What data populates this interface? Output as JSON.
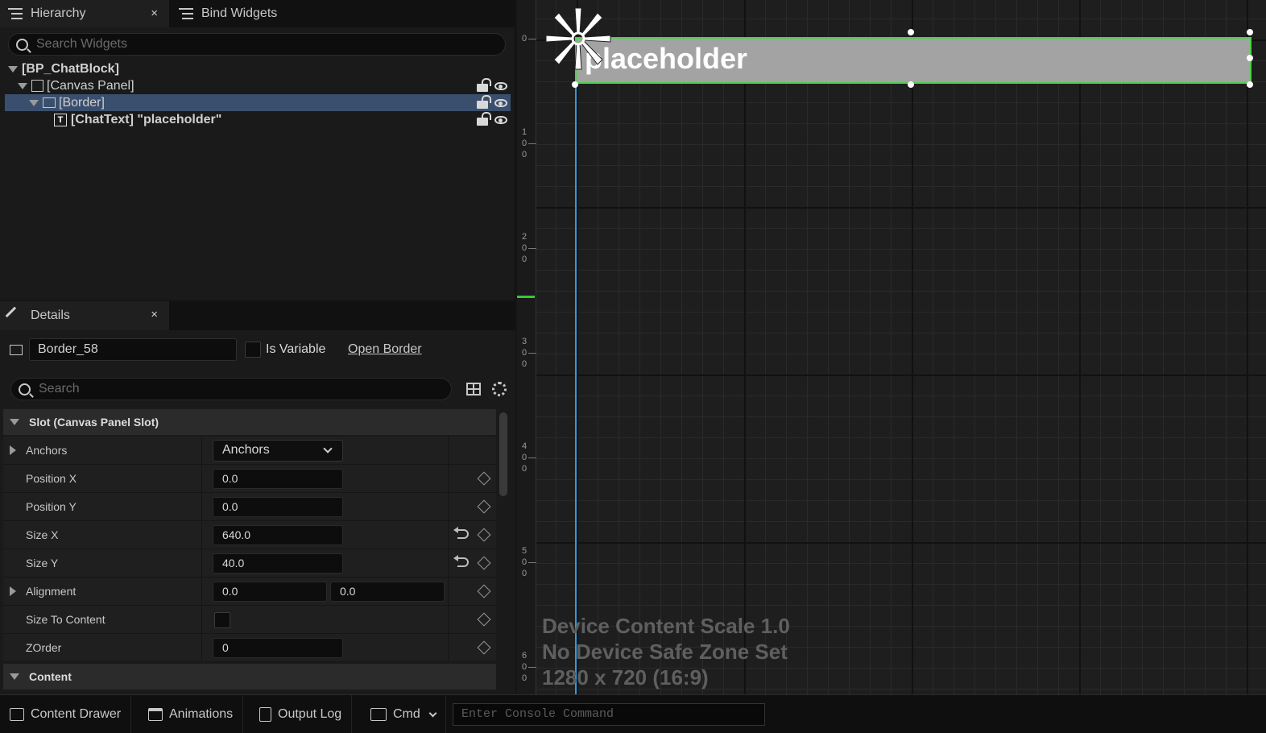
{
  "hierarchy": {
    "tabs": [
      {
        "label": "Hierarchy",
        "active": true
      },
      {
        "label": "Bind Widgets",
        "active": false
      }
    ],
    "close_glyph": "×",
    "search_placeholder": "Search Widgets",
    "tree": [
      {
        "label": "[BP_ChatBlock]",
        "depth": 0,
        "expanded": true
      },
      {
        "label": "[Canvas Panel]",
        "depth": 1,
        "expanded": true
      },
      {
        "label": "[Border]",
        "depth": 2,
        "expanded": true,
        "selected": true
      },
      {
        "label": "[ChatText] \"placeholder\"",
        "depth": 3,
        "icon": "T"
      }
    ]
  },
  "details": {
    "tab_label": "Details",
    "close_glyph": "×",
    "widget_name": "Border_58",
    "is_variable_label": "Is Variable",
    "open_link": "Open Border",
    "search_placeholder": "Search",
    "slot_section": "Slot (Canvas Panel Slot)",
    "content_section": "Content",
    "properties": {
      "anchors": {
        "label": "Anchors",
        "value": "Anchors"
      },
      "position_x": {
        "label": "Position X",
        "value": "0.0"
      },
      "position_y": {
        "label": "Position Y",
        "value": "0.0"
      },
      "size_x": {
        "label": "Size X",
        "value": "640.0"
      },
      "size_y": {
        "label": "Size Y",
        "value": "40.0"
      },
      "alignment": {
        "label": "Alignment",
        "value_x": "0.0",
        "value_y": "0.0"
      },
      "size_to_content": {
        "label": "Size To Content",
        "checked": false
      },
      "zorder": {
        "label": "ZOrder",
        "value": "0"
      }
    }
  },
  "viewport": {
    "widget_text": "placeholder",
    "ruler_labels": [
      "0",
      "100",
      "200",
      "300",
      "400",
      "500",
      "600"
    ],
    "device_info": [
      "Device Content Scale 1.0",
      "No Device Safe Zone Set",
      "1280 x 720 (16:9)"
    ]
  },
  "bottom_bar": {
    "content_drawer": "Content Drawer",
    "animations": "Animations",
    "output_log": "Output Log",
    "cmd": "Cmd",
    "console_placeholder": "Enter Console Command"
  },
  "colors": {
    "selection": "#3a4f6e",
    "guide": "#2e9ce0",
    "widget_outline": "#4bd04b",
    "widget_fill": "#a3a3a3"
  }
}
